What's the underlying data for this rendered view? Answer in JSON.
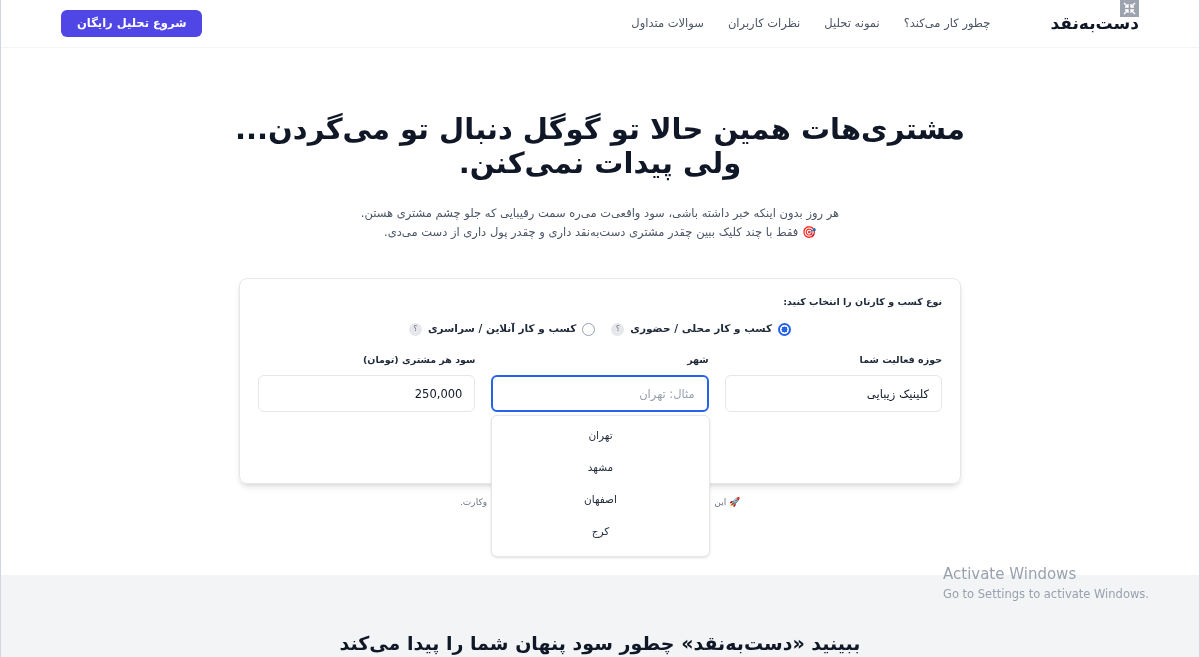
{
  "header": {
    "logo": "دست‌به‌نقد",
    "nav": [
      "چطور کار می‌کند؟",
      "نمونه تحلیل",
      "نظرات کاربران",
      "سوالات متداول"
    ],
    "cta": "شروع تحلیل رایگان"
  },
  "hero": {
    "title_lines": [
      "مشتری‌هات همین حالا تو گوگل دنبال تو می‌گردن...",
      "ولی پیدات نمی‌کنن."
    ],
    "subtitle_lines": [
      "هر روز بدون اینکه خبر داشته باشی، سود واقعی‌ت می‌ره سمت رقیبایی که جلو چشم مشتری هستن.",
      "🎯 فقط با چند کلیک ببین چقدر مشتری دست‌به‌نقد داری و چقدر پول داری از دست می‌دی."
    ]
  },
  "form": {
    "type_label": "نوع کسب و کارتان را انتخاب کنید:",
    "options": [
      {
        "label": "کسب و کار محلی / حضوری",
        "selected": true,
        "help": "؟"
      },
      {
        "label": "کسب و کار آنلاین / سراسری",
        "selected": false,
        "help": "؟"
      }
    ],
    "fields": [
      {
        "label": "حوزه فعالیت شما",
        "value": "کلینیک زیبایی",
        "focused": false
      },
      {
        "label": "شهر",
        "placeholder": "مثال: تهران",
        "focused": true
      },
      {
        "label": "سود هر مشتری (تومان)",
        "value": "250,000",
        "focused": false
      }
    ],
    "suggestions": [
      "تهران",
      "مشهد",
      "اصفهان",
      "کرج"
    ]
  },
  "note": {
    "start": "🚀 این",
    "end": "وکارت."
  },
  "section": {
    "title": "ببینید «دست‌به‌نقد» چطور سود پنهان شما را پیدا می‌کند"
  },
  "os_notice": {
    "title": "Activate Windows",
    "subtitle": "Go to Settings to activate Windows."
  }
}
